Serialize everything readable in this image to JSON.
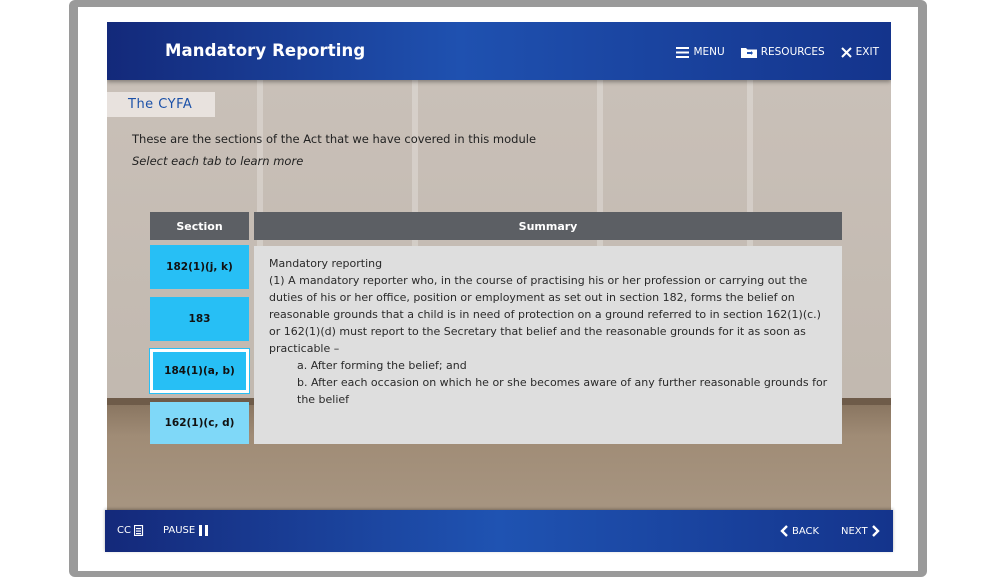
{
  "header": {
    "title": "Mandatory Reporting",
    "menu_label": "MENU",
    "resources_label": "RESOURCES",
    "exit_label": "EXIT"
  },
  "content": {
    "section_heading": "The CYFA",
    "intro": "These are the sections of the Act that we have covered in this module",
    "instruction": "Select each tab to learn more"
  },
  "table": {
    "section_header": "Section",
    "summary_header": "Summary",
    "tabs": [
      {
        "label": "182(1)(j, k)",
        "state": "default"
      },
      {
        "label": "183",
        "state": "default"
      },
      {
        "label": "184(1)(a, b)",
        "state": "selected"
      },
      {
        "label": "162(1)(c, d)",
        "state": "visited"
      }
    ],
    "summary": {
      "title": "Mandatory reporting",
      "body": "(1) A mandatory reporter who, in the course of practising his or her profession or carrying out the duties of his or her office, position or employment as set out in section 182, forms the belief on reasonable grounds that a child is in need of protection on a ground referred to in section 162(1)(c.) or 162(1)(d) must report to the Secretary that belief and the reasonable grounds for it as soon as practicable –",
      "items": [
        "a. After forming the belief; and",
        "b. After each occasion on which he or she becomes aware of any further reasonable grounds for the belief"
      ]
    }
  },
  "footer": {
    "cc_label": "CC",
    "pause_label": "PAUSE",
    "back_label": "BACK",
    "next_label": "NEXT"
  },
  "colors": {
    "bar_blue": "#1f51b0",
    "tab_blue": "#27bff5",
    "tab_visited": "#7fd8f8",
    "header_grey": "#5c5f64",
    "heading_blue": "#1c51a8"
  },
  "icons": {
    "menu": "hamburger-icon",
    "resources": "folder-icon",
    "exit": "close-icon",
    "cc": "captions-icon",
    "pause": "pause-icon",
    "back": "chevron-left-icon",
    "next": "chevron-right-icon"
  }
}
